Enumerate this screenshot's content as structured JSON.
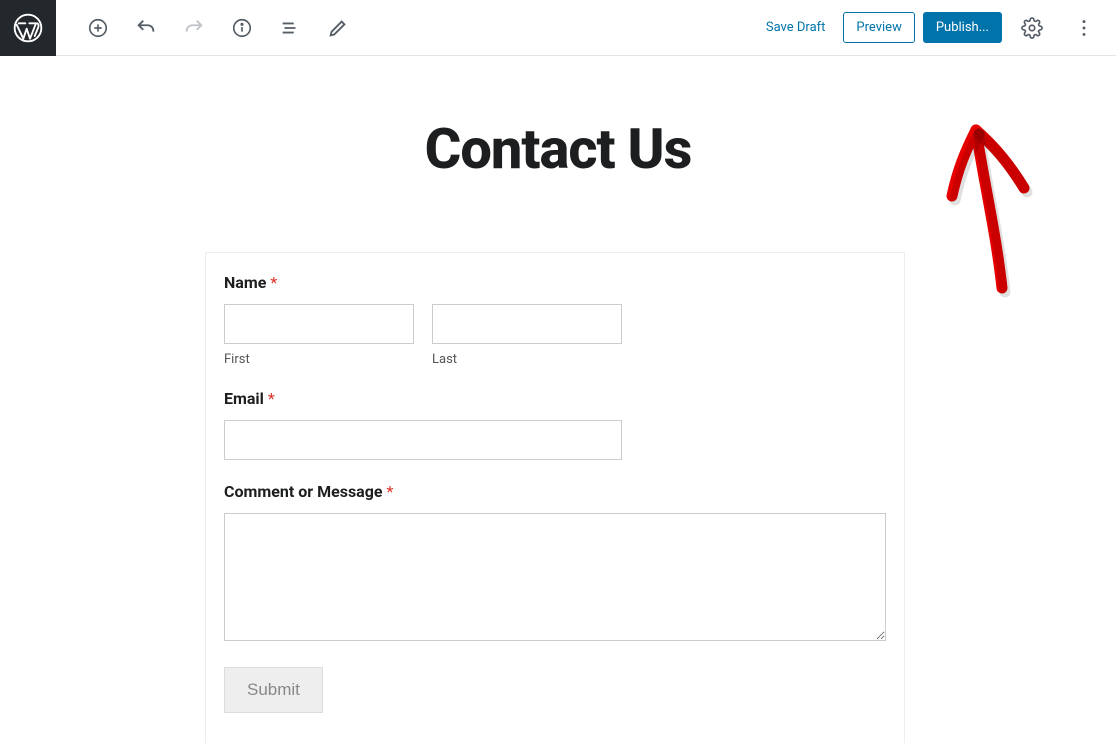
{
  "toolbar": {
    "save_draft": "Save Draft",
    "preview": "Preview",
    "publish": "Publish..."
  },
  "page": {
    "title": "Contact Us"
  },
  "form": {
    "name_label": "Name",
    "first_sub": "First",
    "last_sub": "Last",
    "email_label": "Email",
    "message_label": "Comment or Message",
    "submit_label": "Submit",
    "required_marker": "*"
  }
}
